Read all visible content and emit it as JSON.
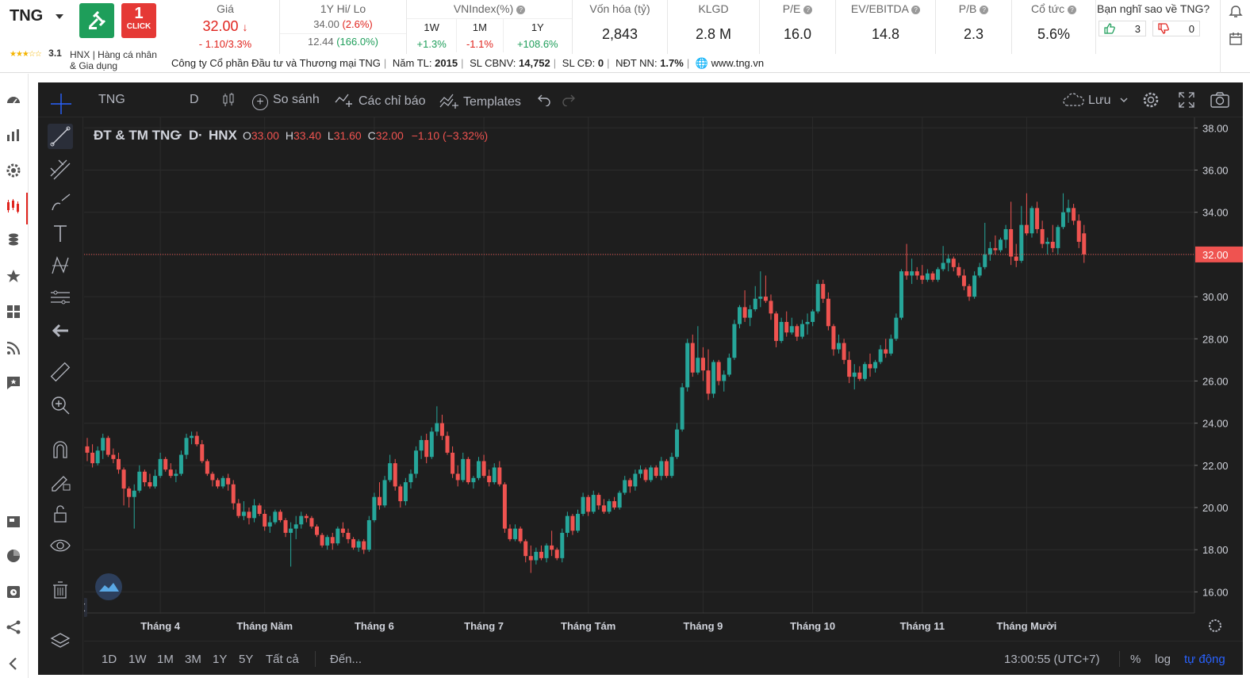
{
  "header": {
    "ticker": "TNG",
    "oneclick_top": "1",
    "oneclick_label": "CLICK",
    "rating": "3.1",
    "rating_stars": "★★★☆☆",
    "exchange": "HNX",
    "industry_separator": "|",
    "industry": "Hàng cá nhân & Gia dụng",
    "price": {
      "label": "Giá",
      "value": "32.00",
      "arrow": "↓",
      "change": "- 1.10/3.3%"
    },
    "hilo": {
      "label": "1Y Hi/ Lo",
      "hi": "34.00",
      "hi_pct": "(2.6%)",
      "lo": "12.44",
      "lo_pct": "(166.0%)"
    },
    "vnindex": {
      "label": "VNIndex(%)",
      "cols": [
        "1W",
        "1M",
        "1Y"
      ],
      "vals": [
        "+1.3%",
        "-1.1%",
        "+108.6%"
      ]
    },
    "metrics": [
      {
        "label": "Vốn hóa (tỷ)",
        "value": "2,843"
      },
      {
        "label": "KLGD",
        "value": "2.8 M"
      },
      {
        "label": "P/E",
        "value": "16.0"
      },
      {
        "label": "EV/EBITDA",
        "value": "14.8"
      },
      {
        "label": "P/B",
        "value": "2.3"
      },
      {
        "label": "Cổ tức",
        "value": "5.6%"
      }
    ],
    "poll": {
      "question": "Bạn nghĩ sao về TNG?",
      "likes": "3",
      "dislikes": "0"
    },
    "company": {
      "name": "Công ty Cổ phần Đầu tư và Thương mại TNG",
      "sep": "|",
      "year_label": "Năm TL:",
      "year": "2015",
      "staff_label": "SL CBNV:",
      "staff": "14,752",
      "shareholders_label": "SL CĐ:",
      "shareholders": "0",
      "foreign_label": "NĐT NN:",
      "foreign": "1.7%",
      "website": "www.tng.vn"
    }
  },
  "toolbar": {
    "symbol": "TNG",
    "interval": "D",
    "compare": "So sánh",
    "indicators": "Các chỉ báo",
    "templates": "Templates",
    "save": "Lưu"
  },
  "legend": {
    "name": "ĐT & TM TNG",
    "dot1": "·",
    "interval": "D",
    "dot2": "·",
    "exchange": "HNX",
    "o_label": "O",
    "o": "33.00",
    "h_label": "H",
    "h": "33.40",
    "l_label": "L",
    "l": "31.60",
    "c_label": "C",
    "c": "32.00",
    "change": "−1.10 (−3.32%)"
  },
  "bottombar": {
    "ranges": [
      "1D",
      "1W",
      "1M",
      "3M",
      "1Y",
      "5Y",
      "Tất cả"
    ],
    "goto": "Đến...",
    "time": "13:00:55 (UTC+7)",
    "percent": "%",
    "log": "log",
    "auto": "tự động"
  },
  "colors": {
    "up": "#26a69a",
    "down": "#ef5350",
    "background": "#1e1e1e",
    "grid": "#2c2c2c",
    "price_line": "#ef5350"
  },
  "chart_data": {
    "type": "candlestick",
    "y_ticks": [
      "16.00",
      "18.00",
      "20.00",
      "22.00",
      "24.00",
      "26.00",
      "28.00",
      "30.00",
      "32.00",
      "34.00",
      "36.00",
      "38.00"
    ],
    "ylim": [
      15.0,
      38.5
    ],
    "x_labels": [
      "Tháng 4",
      "Tháng Năm",
      "Tháng 6",
      "Tháng 7",
      "Tháng Tám",
      "Tháng 9",
      "Tháng 10",
      "Tháng 11",
      "Tháng Mười"
    ],
    "x_label_index": [
      14,
      34,
      55,
      76,
      96,
      118,
      139,
      160,
      180
    ],
    "last_price": "32.00",
    "ohlc": [
      [
        22.9,
        23.3,
        22.2,
        22.6
      ],
      [
        22.6,
        23.0,
        21.9,
        22.1
      ],
      [
        22.1,
        22.9,
        22.0,
        22.7
      ],
      [
        22.7,
        23.5,
        22.3,
        23.3
      ],
      [
        23.3,
        23.4,
        22.4,
        22.5
      ],
      [
        22.5,
        22.8,
        22.1,
        22.3
      ],
      [
        22.3,
        22.6,
        21.6,
        21.8
      ],
      [
        21.8,
        21.9,
        20.1,
        20.9
      ],
      [
        20.9,
        21.0,
        20.0,
        20.5
      ],
      [
        20.5,
        21.1,
        19.0,
        20.8
      ],
      [
        20.8,
        22.0,
        20.7,
        21.7
      ],
      [
        21.7,
        21.8,
        21.0,
        21.2
      ],
      [
        21.2,
        21.6,
        20.9,
        21.0
      ],
      [
        21.0,
        21.8,
        20.9,
        21.5
      ],
      [
        21.5,
        22.6,
        21.4,
        22.3
      ],
      [
        22.3,
        22.4,
        21.7,
        21.8
      ],
      [
        21.8,
        22.1,
        21.4,
        21.5
      ],
      [
        21.5,
        21.8,
        21.2,
        21.6
      ],
      [
        21.6,
        22.7,
        21.5,
        22.5
      ],
      [
        22.5,
        23.5,
        22.3,
        23.3
      ],
      [
        23.3,
        23.6,
        23.0,
        23.4
      ],
      [
        23.4,
        23.6,
        22.9,
        23.0
      ],
      [
        23.0,
        23.2,
        22.1,
        22.2
      ],
      [
        22.2,
        22.3,
        21.5,
        21.6
      ],
      [
        21.6,
        21.7,
        21.0,
        21.3
      ],
      [
        21.3,
        21.4,
        20.9,
        21.0
      ],
      [
        21.0,
        21.5,
        20.9,
        21.4
      ],
      [
        21.4,
        21.6,
        20.8,
        21.1
      ],
      [
        21.1,
        21.3,
        19.9,
        20.2
      ],
      [
        20.2,
        20.4,
        19.5,
        19.6
      ],
      [
        19.6,
        20.3,
        19.4,
        19.8
      ],
      [
        19.8,
        20.0,
        19.2,
        19.5
      ],
      [
        19.5,
        20.4,
        19.3,
        20.1
      ],
      [
        20.1,
        20.2,
        19.6,
        19.7
      ],
      [
        19.7,
        19.9,
        18.9,
        19.1
      ],
      [
        19.1,
        19.6,
        18.8,
        19.3
      ],
      [
        19.3,
        19.9,
        19.2,
        19.8
      ],
      [
        19.8,
        19.9,
        19.3,
        19.4
      ],
      [
        19.4,
        19.5,
        18.6,
        18.8
      ],
      [
        18.8,
        19.3,
        17.2,
        19.0
      ],
      [
        19.0,
        19.6,
        18.5,
        19.2
      ],
      [
        19.2,
        19.8,
        19.0,
        19.6
      ],
      [
        19.6,
        19.7,
        19.3,
        19.5
      ],
      [
        19.5,
        19.6,
        19.0,
        19.1
      ],
      [
        19.1,
        19.2,
        18.6,
        18.7
      ],
      [
        18.7,
        18.8,
        18.1,
        18.2
      ],
      [
        18.2,
        18.7,
        18.0,
        18.6
      ],
      [
        18.6,
        18.8,
        18.0,
        18.3
      ],
      [
        18.3,
        19.1,
        18.2,
        19.0
      ],
      [
        19.0,
        19.3,
        18.6,
        18.8
      ],
      [
        18.8,
        19.0,
        18.3,
        18.5
      ],
      [
        18.5,
        18.6,
        18.0,
        18.1
      ],
      [
        18.1,
        18.5,
        17.9,
        18.4
      ],
      [
        18.4,
        18.5,
        17.8,
        18.0
      ],
      [
        18.0,
        19.6,
        17.9,
        19.4
      ],
      [
        19.4,
        20.7,
        19.3,
        20.5
      ],
      [
        20.5,
        21.2,
        19.9,
        20.1
      ],
      [
        20.1,
        21.5,
        20.0,
        21.3
      ],
      [
        21.3,
        22.5,
        21.2,
        22.1
      ],
      [
        22.1,
        22.3,
        20.8,
        21.0
      ],
      [
        21.0,
        21.1,
        20.0,
        20.3
      ],
      [
        20.3,
        21.4,
        20.1,
        21.2
      ],
      [
        21.2,
        21.8,
        20.9,
        21.6
      ],
      [
        21.6,
        22.9,
        21.4,
        22.7
      ],
      [
        22.7,
        23.4,
        22.3,
        23.2
      ],
      [
        23.2,
        23.5,
        22.1,
        22.4
      ],
      [
        22.4,
        23.8,
        22.3,
        23.6
      ],
      [
        23.6,
        24.8,
        23.4,
        24.0
      ],
      [
        24.0,
        24.4,
        23.2,
        23.4
      ],
      [
        23.4,
        23.6,
        22.5,
        22.6
      ],
      [
        22.6,
        22.9,
        21.4,
        21.6
      ],
      [
        21.6,
        22.0,
        21.0,
        21.3
      ],
      [
        21.3,
        22.6,
        21.2,
        22.3
      ],
      [
        22.3,
        22.4,
        21.1,
        21.2
      ],
      [
        21.2,
        21.5,
        20.9,
        21.4
      ],
      [
        21.4,
        22.4,
        21.3,
        22.2
      ],
      [
        22.2,
        22.5,
        21.4,
        21.5
      ],
      [
        21.5,
        21.8,
        21.0,
        21.2
      ],
      [
        21.2,
        22.1,
        21.1,
        21.9
      ],
      [
        21.9,
        22.2,
        21.0,
        21.1
      ],
      [
        21.1,
        21.2,
        18.8,
        19.0
      ],
      [
        19.0,
        19.2,
        18.4,
        18.5
      ],
      [
        18.5,
        19.2,
        18.4,
        19.0
      ],
      [
        19.0,
        19.1,
        18.3,
        18.4
      ],
      [
        18.4,
        18.5,
        17.4,
        17.7
      ],
      [
        17.7,
        18.2,
        16.9,
        17.5
      ],
      [
        17.5,
        18.1,
        17.3,
        17.9
      ],
      [
        17.9,
        18.2,
        17.5,
        17.6
      ],
      [
        17.6,
        18.3,
        17.4,
        18.2
      ],
      [
        18.2,
        18.9,
        17.7,
        18.0
      ],
      [
        18.0,
        18.1,
        17.5,
        17.6
      ],
      [
        17.6,
        19.0,
        17.4,
        18.8
      ],
      [
        18.8,
        19.8,
        18.6,
        19.6
      ],
      [
        19.6,
        19.7,
        18.7,
        18.9
      ],
      [
        18.9,
        19.9,
        18.8,
        19.7
      ],
      [
        19.7,
        20.7,
        19.6,
        20.5
      ],
      [
        20.5,
        20.6,
        19.6,
        19.8
      ],
      [
        19.8,
        20.8,
        19.7,
        20.6
      ],
      [
        20.6,
        20.7,
        19.9,
        20.1
      ],
      [
        20.1,
        20.4,
        19.7,
        19.8
      ],
      [
        19.8,
        20.4,
        19.7,
        20.3
      ],
      [
        20.3,
        20.5,
        19.9,
        20.0
      ],
      [
        20.0,
        20.8,
        19.9,
        20.7
      ],
      [
        20.7,
        21.5,
        20.6,
        21.3
      ],
      [
        21.3,
        21.4,
        20.7,
        21.0
      ],
      [
        21.0,
        21.8,
        20.8,
        21.6
      ],
      [
        21.6,
        22.0,
        21.4,
        21.8
      ],
      [
        21.8,
        21.9,
        21.2,
        21.3
      ],
      [
        21.3,
        22.0,
        21.2,
        21.9
      ],
      [
        21.9,
        22.0,
        21.4,
        21.5
      ],
      [
        21.5,
        22.4,
        21.3,
        22.2
      ],
      [
        22.2,
        22.3,
        21.4,
        21.5
      ],
      [
        21.5,
        22.6,
        21.4,
        22.4
      ],
      [
        22.4,
        24.0,
        22.3,
        23.7
      ],
      [
        23.7,
        25.9,
        23.6,
        25.7
      ],
      [
        25.7,
        28.0,
        25.5,
        27.8
      ],
      [
        27.8,
        28.2,
        26.2,
        26.4
      ],
      [
        26.4,
        28.6,
        26.3,
        27.1
      ],
      [
        27.1,
        27.6,
        26.0,
        26.5
      ],
      [
        26.5,
        27.5,
        25.1,
        25.4
      ],
      [
        25.4,
        27.0,
        25.2,
        26.9
      ],
      [
        26.9,
        27.0,
        25.8,
        26.0
      ],
      [
        26.0,
        26.5,
        25.5,
        26.3
      ],
      [
        26.3,
        27.3,
        26.2,
        27.1
      ],
      [
        27.1,
        28.9,
        27.0,
        28.7
      ],
      [
        28.7,
        29.6,
        28.5,
        29.5
      ],
      [
        29.5,
        30.3,
        28.8,
        29.0
      ],
      [
        29.0,
        29.6,
        28.6,
        29.4
      ],
      [
        29.4,
        30.5,
        29.3,
        29.9
      ],
      [
        29.9,
        31.2,
        29.5,
        30.0
      ],
      [
        30.0,
        31.0,
        29.7,
        29.8
      ],
      [
        29.8,
        30.1,
        28.9,
        29.2
      ],
      [
        29.2,
        29.3,
        27.6,
        27.9
      ],
      [
        27.9,
        29.0,
        27.8,
        28.8
      ],
      [
        28.8,
        29.3,
        28.1,
        28.3
      ],
      [
        28.3,
        29.0,
        28.2,
        28.6
      ],
      [
        28.6,
        28.7,
        27.9,
        28.1
      ],
      [
        28.1,
        28.9,
        28.0,
        28.7
      ],
      [
        28.7,
        29.2,
        28.2,
        28.8
      ],
      [
        28.8,
        29.4,
        28.6,
        29.3
      ],
      [
        29.3,
        30.8,
        29.2,
        30.6
      ],
      [
        30.6,
        30.8,
        29.7,
        29.9
      ],
      [
        29.9,
        30.2,
        28.4,
        28.6
      ],
      [
        28.6,
        28.7,
        27.2,
        27.5
      ],
      [
        27.5,
        28.2,
        27.3,
        27.8
      ],
      [
        27.8,
        28.0,
        26.8,
        27.0
      ],
      [
        27.0,
        27.4,
        25.9,
        26.2
      ],
      [
        26.2,
        26.8,
        25.6,
        26.4
      ],
      [
        26.4,
        26.7,
        26.0,
        26.1
      ],
      [
        26.1,
        26.9,
        26.0,
        26.8
      ],
      [
        26.8,
        27.3,
        26.2,
        26.6
      ],
      [
        26.6,
        27.0,
        26.4,
        26.9
      ],
      [
        26.9,
        27.7,
        26.8,
        27.5
      ],
      [
        27.5,
        28.0,
        27.1,
        27.3
      ],
      [
        27.3,
        28.2,
        27.2,
        28.0
      ],
      [
        28.0,
        29.2,
        27.9,
        29.0
      ],
      [
        29.0,
        31.3,
        28.9,
        31.2
      ],
      [
        31.2,
        32.5,
        30.8,
        31.0
      ],
      [
        31.0,
        31.8,
        30.6,
        31.2
      ],
      [
        31.2,
        31.4,
        30.8,
        31.0
      ],
      [
        31.0,
        31.5,
        30.6,
        30.8
      ],
      [
        30.8,
        31.3,
        30.7,
        31.1
      ],
      [
        31.1,
        31.2,
        30.7,
        30.8
      ],
      [
        30.8,
        31.4,
        30.7,
        31.3
      ],
      [
        31.3,
        32.4,
        31.2,
        31.6
      ],
      [
        31.6,
        32.0,
        31.2,
        31.8
      ],
      [
        31.8,
        31.9,
        31.2,
        31.4
      ],
      [
        31.4,
        31.6,
        30.9,
        31.0
      ],
      [
        31.0,
        31.3,
        30.3,
        30.5
      ],
      [
        30.5,
        30.6,
        29.8,
        30.0
      ],
      [
        30.0,
        31.2,
        29.9,
        31.0
      ],
      [
        31.0,
        31.6,
        30.9,
        31.4
      ],
      [
        31.4,
        33.5,
        31.3,
        32.0
      ],
      [
        32.0,
        32.6,
        31.7,
        32.3
      ],
      [
        32.3,
        32.9,
        32.0,
        32.2
      ],
      [
        32.2,
        32.8,
        32.1,
        32.7
      ],
      [
        32.7,
        33.4,
        32.3,
        33.2
      ],
      [
        33.2,
        34.5,
        31.5,
        31.9
      ],
      [
        31.9,
        32.5,
        31.4,
        31.7
      ],
      [
        31.7,
        34.3,
        31.6,
        33.4
      ],
      [
        33.4,
        34.9,
        32.9,
        33.0
      ],
      [
        33.0,
        34.3,
        32.8,
        34.2
      ],
      [
        34.2,
        34.5,
        33.0,
        33.2
      ],
      [
        33.2,
        33.6,
        32.3,
        32.5
      ],
      [
        32.5,
        32.8,
        32.0,
        32.6
      ],
      [
        32.6,
        33.4,
        32.1,
        32.3
      ],
      [
        32.3,
        33.4,
        32.0,
        33.3
      ],
      [
        33.3,
        34.9,
        33.2,
        34.0
      ],
      [
        34.0,
        34.6,
        33.5,
        34.2
      ],
      [
        34.2,
        34.4,
        33.4,
        33.6
      ],
      [
        33.6,
        33.9,
        32.3,
        32.6
      ],
      [
        33.0,
        33.4,
        31.6,
        32.0
      ]
    ]
  }
}
